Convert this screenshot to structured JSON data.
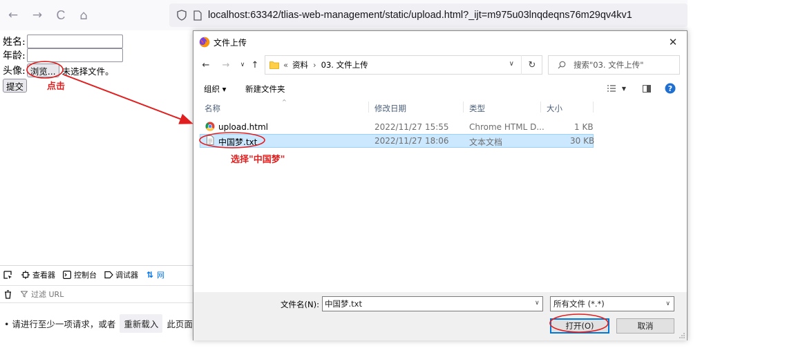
{
  "browser": {
    "url": "localhost:63342/tlias-web-management/static/upload.html?_ijt=m975u03lnqdeqns76m29qv4kv1",
    "back_glyph": "←",
    "forward_glyph": "→",
    "reload_glyph": "C",
    "home_glyph": "⌂"
  },
  "form": {
    "name_label": "姓名:",
    "age_label": "年龄:",
    "avatar_label": "头像:",
    "browse_label": "浏览...",
    "no_file_text": "未选择文件。",
    "submit_label": "提交"
  },
  "annotations": {
    "click_hint": "点击",
    "select_hint": "选择\"中国梦\""
  },
  "devtools": {
    "tabs": [
      {
        "label": "查看器",
        "icon": "inspector-icon"
      },
      {
        "label": "控制台",
        "icon": "console-icon"
      },
      {
        "label": "调试器",
        "icon": "debugger-icon"
      },
      {
        "label": "网",
        "icon": "network-icon"
      }
    ],
    "filter_placeholder": "过滤 URL",
    "message_prefix": "• 请进行至少一项请求，或者",
    "reload_label": "重新载入",
    "message_suffix": "此页面以"
  },
  "dialog": {
    "title": "文件上传",
    "close_glyph": "✕",
    "address_prefix": "«",
    "address_parts": [
      "资料",
      "03. 文件上传"
    ],
    "address_separator": "›",
    "search_placeholder": "搜索\"03. 文件上传\"",
    "organize_label": "组织 ▾",
    "new_folder_label": "新建文件夹",
    "columns": [
      "名称",
      "修改日期",
      "类型",
      "大小"
    ],
    "files": [
      {
        "name": "upload.html",
        "date": "2022/11/27 15:55",
        "type": "Chrome HTML D...",
        "size": "1 KB",
        "icon": "chrome-icon",
        "selected": false
      },
      {
        "name": "中国梦.txt",
        "date": "2022/11/27 18:06",
        "type": "文本文档",
        "size": "30 KB",
        "icon": "text-file-icon",
        "selected": true
      }
    ],
    "filename_label": "文件名(N):",
    "filename_value": "中国梦.txt",
    "filetype_value": "所有文件 (*.*)",
    "open_label": "打开(O)",
    "cancel_label": "取消"
  },
  "colors": {
    "annotation_red": "#e02020",
    "selection_bg": "#cce8ff",
    "focus_blue": "#0078d7",
    "devtools_active": "#0074e8"
  }
}
